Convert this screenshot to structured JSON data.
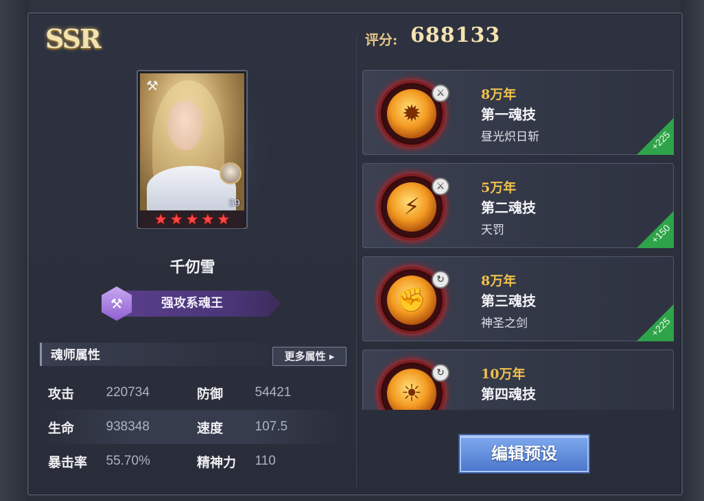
{
  "rarity": "SSR",
  "score": {
    "label": "评分:",
    "value": "688133"
  },
  "hero": {
    "name": "千仞雪",
    "level": "59",
    "stars": 5,
    "class_label": "强攻系魂王"
  },
  "attributes": {
    "title": "魂师属性",
    "more_button": "更多属性",
    "rows": [
      {
        "label1": "攻击",
        "value1": "220734",
        "label2": "防御",
        "value2": "54421"
      },
      {
        "label1": "生命",
        "value1": "938348",
        "label2": "速度",
        "value2": "107.5"
      },
      {
        "label1": "暴击率",
        "value1": "55.70%",
        "label2": "精神力",
        "value2": "110"
      }
    ]
  },
  "skills": [
    {
      "age": "8万年",
      "title": "第一魂技",
      "name": "昼光炽日斩",
      "plus": "+225"
    },
    {
      "age": "5万年",
      "title": "第二魂技",
      "name": "天罚",
      "plus": "+150"
    },
    {
      "age": "8万年",
      "title": "第三魂技",
      "name": "神圣之剑",
      "plus": "+225"
    },
    {
      "age": "10万年",
      "title": "第四魂技",
      "name": "",
      "plus": ""
    }
  ],
  "edit_button": "编辑预设",
  "colors": {
    "accent_gold": "#f1c14c",
    "star_red": "#ff4646",
    "button_blue": "#4d78cc",
    "class_purple": "#5a3f8c"
  }
}
